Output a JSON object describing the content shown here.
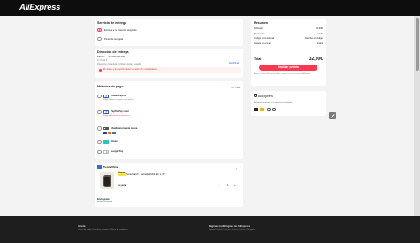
{
  "header": {
    "logo": "AliExpress"
  },
  "delivery": {
    "title": "Servicio de entrega",
    "option_home": "Entrega a tu dirección asignada",
    "option_pickup": "Punto de recogida"
  },
  "address": {
    "title": "Dirección de entrega",
    "name": "Cliente",
    "phone": "+34 000 000 000",
    "line1": "C/ Calle 1",
    "line2": "Dirección completa, Código postal, España",
    "edit_label": "Modificar",
    "warning": "El número y la dirección deben coincidir con el destinatario"
  },
  "payment": {
    "title": "Métodos de pago",
    "see_all": "Ver más",
    "methods": [
      {
        "label": "Añadir PayPal",
        "note": "Paga de forma segura con PayPal"
      },
      {
        "label": "PayPal Pay Later",
        "note": "Paga en 3 plazos sin intereses"
      },
      {
        "label": "Añadir una tarjeta nueva",
        "note": ""
      },
      {
        "label": "Bizum",
        "note": ""
      },
      {
        "label": "Google Pay",
        "note": ""
      }
    ]
  },
  "store": {
    "name": "Tienda Oficial",
    "badge": "Choice",
    "product_title": "Smartwatch , pantalla AMOLED, 1,43\"",
    "price": "34,90€",
    "quantity": "1",
    "delivery_label": "Envío gratis",
    "delivery_note": "Entrega estimada"
  },
  "summary": {
    "title": "Resumen",
    "rows": [
      {
        "label": "Subtotal",
        "value": "34,90€"
      },
      {
        "label": "Descuento",
        "value": "-2,00€"
      },
      {
        "label": "Código promocional",
        "value": "Escribe el código"
      },
      {
        "label": "Gastos de envío",
        "value": "Gratis"
      }
    ],
    "total_label": "Total",
    "total_value": "32,90€",
    "cta": "Realizar pedido",
    "legal": "Al hacer clic en «Realizar pedido» aceptas las condiciones de AliExpress."
  },
  "trust": {
    "title": "AliExpress",
    "text": "AliExpress protege tus pagos con seguridad."
  },
  "footer": {
    "col1_title": "Ayuda",
    "col1_text": "Centro de ayuda, Disputas y reportes, Políticas de reembolso",
    "col2_title": "Páginas multilingües de AliExpress",
    "col2_text": "Español, English, Français, Deutsch, Italiano, Português"
  },
  "colors": {
    "accent": "#fd384f",
    "link": "#2e6fd6",
    "topbar": "#0d0d0d",
    "footer": "#1e1e1e"
  }
}
